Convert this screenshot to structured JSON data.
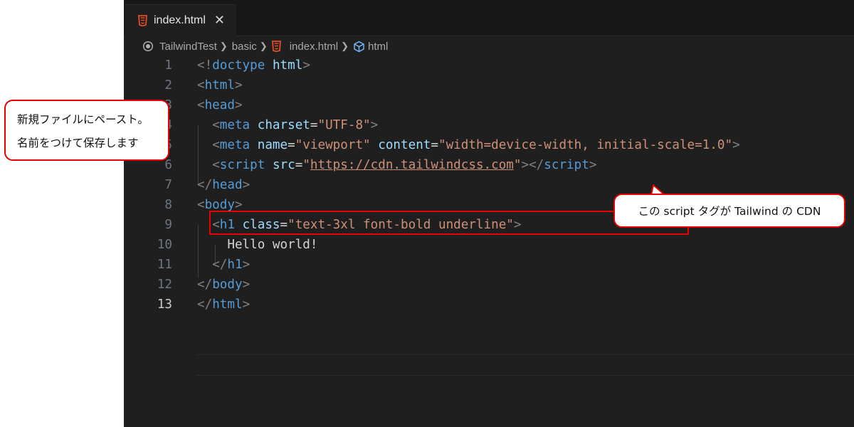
{
  "tab": {
    "title": "index.html",
    "close_icon": "close-icon"
  },
  "breadcrumb": {
    "items": [
      "TailwindTest",
      "basic",
      "index.html",
      "html"
    ]
  },
  "annotations": {
    "left_line1": "新規ファイルにペースト。",
    "left_line2": "名前をつけて保存します",
    "right": "この script タグが Tailwind の CDN"
  },
  "colors": {
    "highlight": "#e60000",
    "tag": "#569cd6",
    "attribute": "#9cdcfe",
    "string": "#ce9178"
  },
  "code": {
    "active_line": 13,
    "highlighted_line": 6,
    "lines": [
      {
        "n": "1",
        "tokens": [
          [
            "br",
            "<!"
          ],
          [
            "tag",
            "doctype"
          ],
          [
            "txt",
            " "
          ],
          [
            "attr",
            "html"
          ],
          [
            "br",
            ">"
          ]
        ]
      },
      {
        "n": "2",
        "tokens": [
          [
            "br",
            "<"
          ],
          [
            "tag",
            "html"
          ],
          [
            "br",
            ">"
          ]
        ]
      },
      {
        "n": "3",
        "tokens": [
          [
            "br",
            "<"
          ],
          [
            "tag",
            "head"
          ],
          [
            "br",
            ">"
          ]
        ]
      },
      {
        "n": "4",
        "tokens": [
          [
            "txt",
            "  "
          ],
          [
            "br",
            "<"
          ],
          [
            "tag",
            "meta"
          ],
          [
            "txt",
            " "
          ],
          [
            "attr",
            "charset"
          ],
          [
            "txt",
            "="
          ],
          [
            "str",
            "\"UTF-8\""
          ],
          [
            "br",
            ">"
          ]
        ]
      },
      {
        "n": "5",
        "tokens": [
          [
            "txt",
            "  "
          ],
          [
            "br",
            "<"
          ],
          [
            "tag",
            "meta"
          ],
          [
            "txt",
            " "
          ],
          [
            "attr",
            "name"
          ],
          [
            "txt",
            "="
          ],
          [
            "str",
            "\"viewport\""
          ],
          [
            "txt",
            " "
          ],
          [
            "attr",
            "content"
          ],
          [
            "txt",
            "="
          ],
          [
            "str",
            "\"width=device-width, initial-scale=1.0\""
          ],
          [
            "br",
            ">"
          ]
        ]
      },
      {
        "n": "6",
        "tokens": [
          [
            "txt",
            "  "
          ],
          [
            "br",
            "<"
          ],
          [
            "tag",
            "script"
          ],
          [
            "txt",
            " "
          ],
          [
            "attr",
            "src"
          ],
          [
            "txt",
            "="
          ],
          [
            "str",
            "\""
          ],
          [
            "url",
            "https://cdn.tailwindcss.com"
          ],
          [
            "str",
            "\""
          ],
          [
            "br",
            "></"
          ],
          [
            "tag",
            "script"
          ],
          [
            "br",
            ">"
          ]
        ]
      },
      {
        "n": "7",
        "tokens": [
          [
            "br",
            "</"
          ],
          [
            "tag",
            "head"
          ],
          [
            "br",
            ">"
          ]
        ]
      },
      {
        "n": "8",
        "tokens": [
          [
            "br",
            "<"
          ],
          [
            "tag",
            "body"
          ],
          [
            "br",
            ">"
          ]
        ]
      },
      {
        "n": "9",
        "tokens": [
          [
            "txt",
            "  "
          ],
          [
            "br",
            "<"
          ],
          [
            "tag",
            "h1"
          ],
          [
            "txt",
            " "
          ],
          [
            "attr",
            "class"
          ],
          [
            "txt",
            "="
          ],
          [
            "str",
            "\"text-3xl font-bold underline\""
          ],
          [
            "br",
            ">"
          ]
        ]
      },
      {
        "n": "10",
        "tokens": [
          [
            "txt",
            "    Hello world!"
          ]
        ]
      },
      {
        "n": "11",
        "tokens": [
          [
            "txt",
            "  "
          ],
          [
            "br",
            "</"
          ],
          [
            "tag",
            "h1"
          ],
          [
            "br",
            ">"
          ]
        ]
      },
      {
        "n": "12",
        "tokens": [
          [
            "br",
            "</"
          ],
          [
            "tag",
            "body"
          ],
          [
            "br",
            ">"
          ]
        ]
      },
      {
        "n": "13",
        "tokens": [
          [
            "br",
            "</"
          ],
          [
            "tag",
            "html"
          ],
          [
            "br",
            ">"
          ]
        ]
      }
    ]
  }
}
